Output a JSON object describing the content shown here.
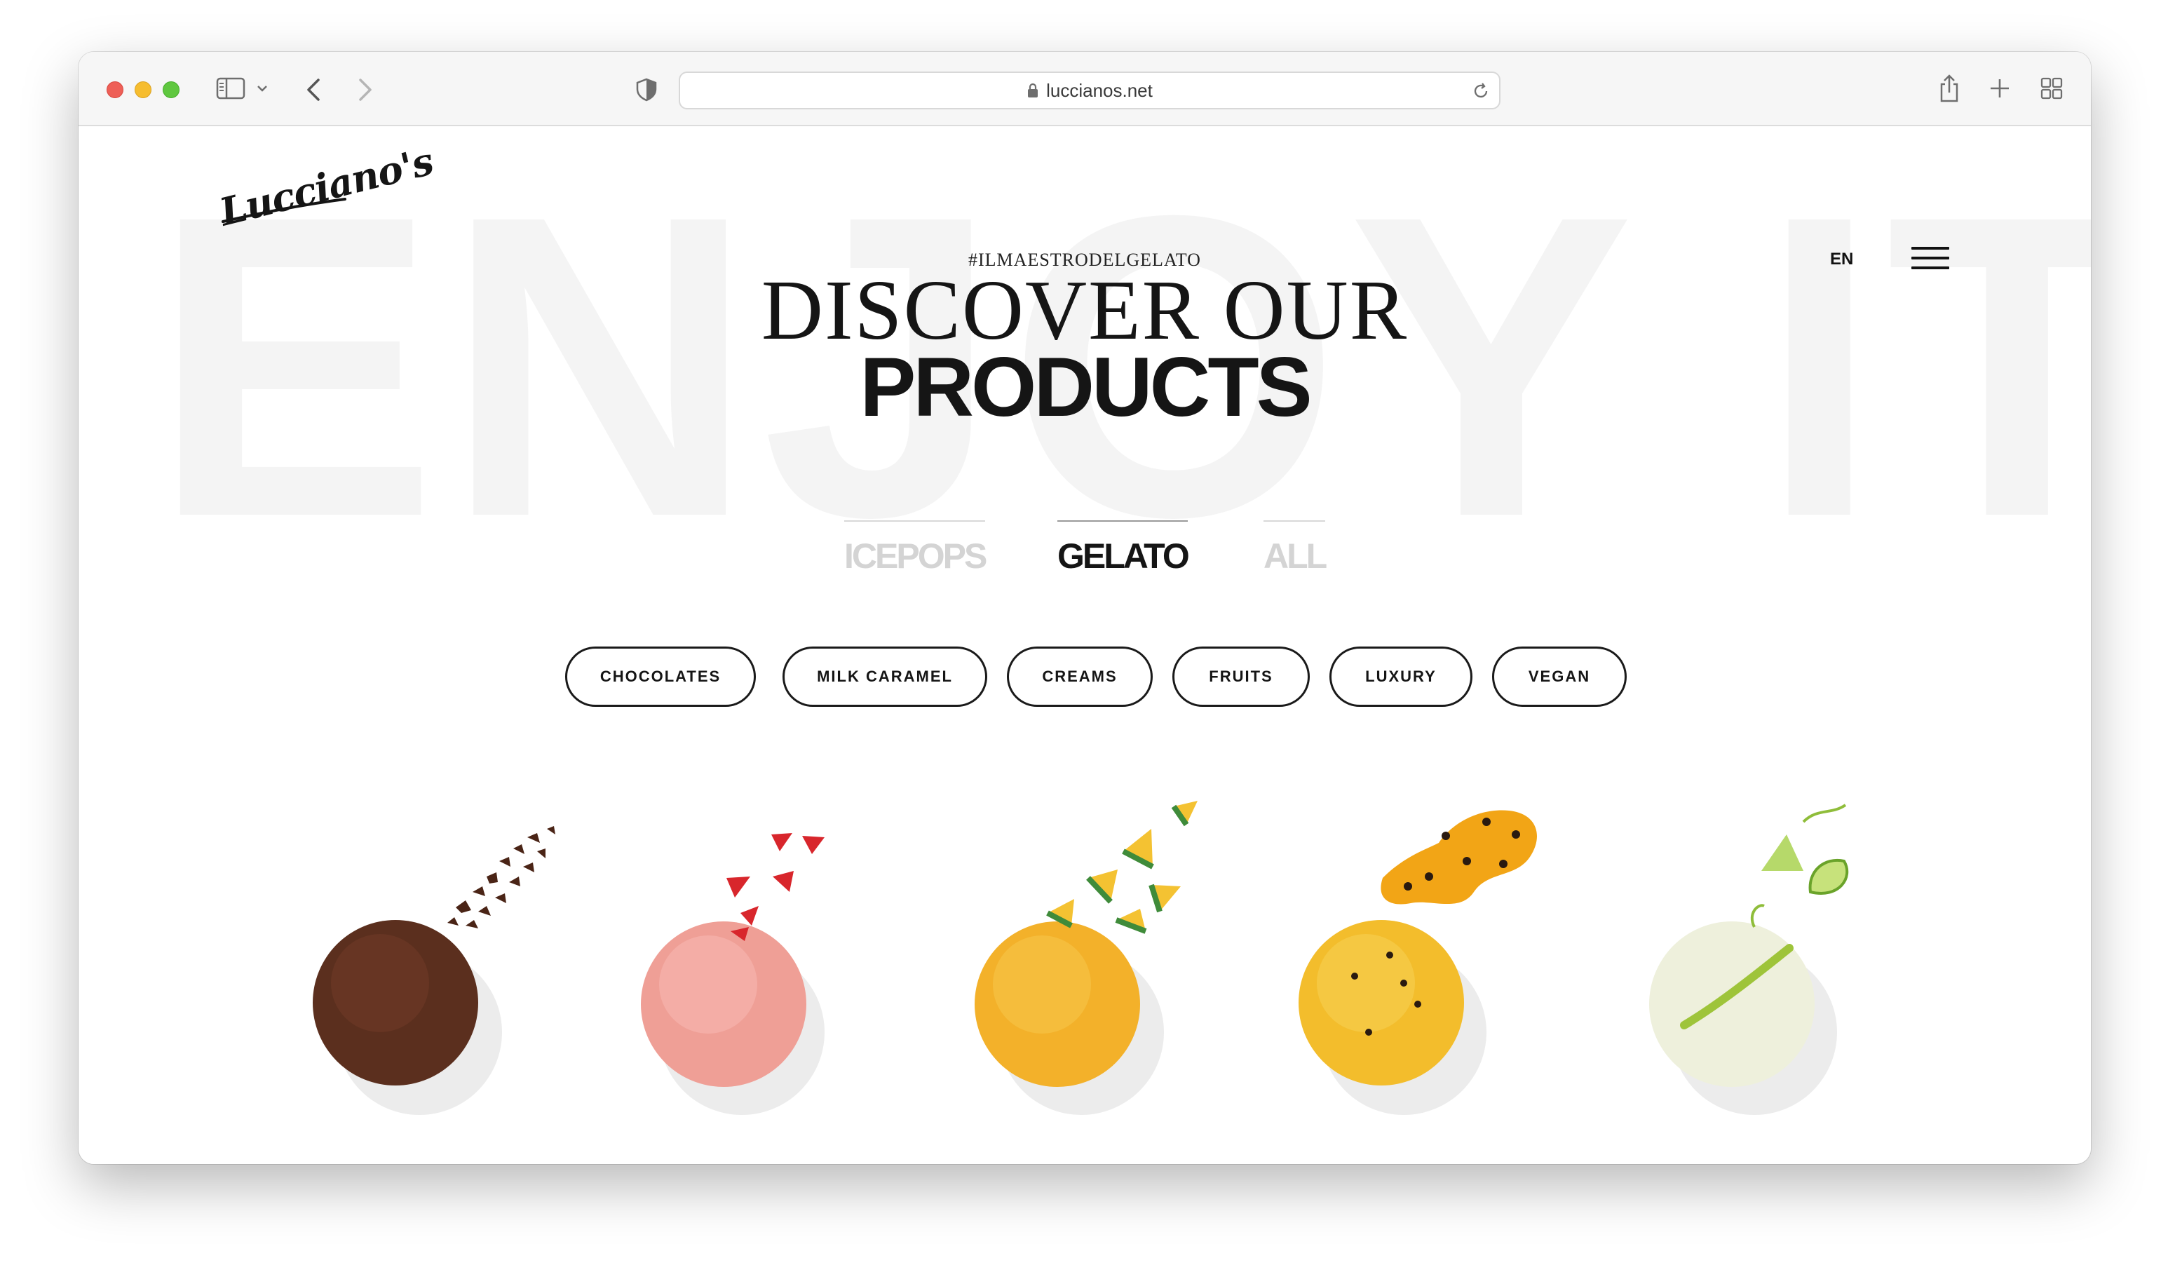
{
  "browser": {
    "url": "luccianos.net"
  },
  "page": {
    "background_word": "ENJOY IT",
    "logo_text": "Lucciano's",
    "hashtag": "#ILMAESTRODELGELATO",
    "language": "EN",
    "title_line1": "DISCOVER OUR",
    "title_line2": "PRODUCTS",
    "category_tabs": [
      {
        "label": "ICEPOPS",
        "active": false
      },
      {
        "label": "GELATO",
        "active": true
      },
      {
        "label": "ALL",
        "active": false
      }
    ],
    "filters": [
      "CHOCOLATES",
      "MILK CARAMEL",
      "CREAMS",
      "FRUITS",
      "LUXURY",
      "VEGAN"
    ],
    "products": [
      {
        "name": "chocolate-gelato",
        "color": "#6b3a24"
      },
      {
        "name": "strawberry-gelato",
        "color": "#f0a29a"
      },
      {
        "name": "mango-gelato",
        "color": "#f4b42a"
      },
      {
        "name": "passion-fruit-gelato",
        "color": "#f5c02d"
      },
      {
        "name": "lime-gelato",
        "color": "#eef0d8"
      }
    ]
  }
}
